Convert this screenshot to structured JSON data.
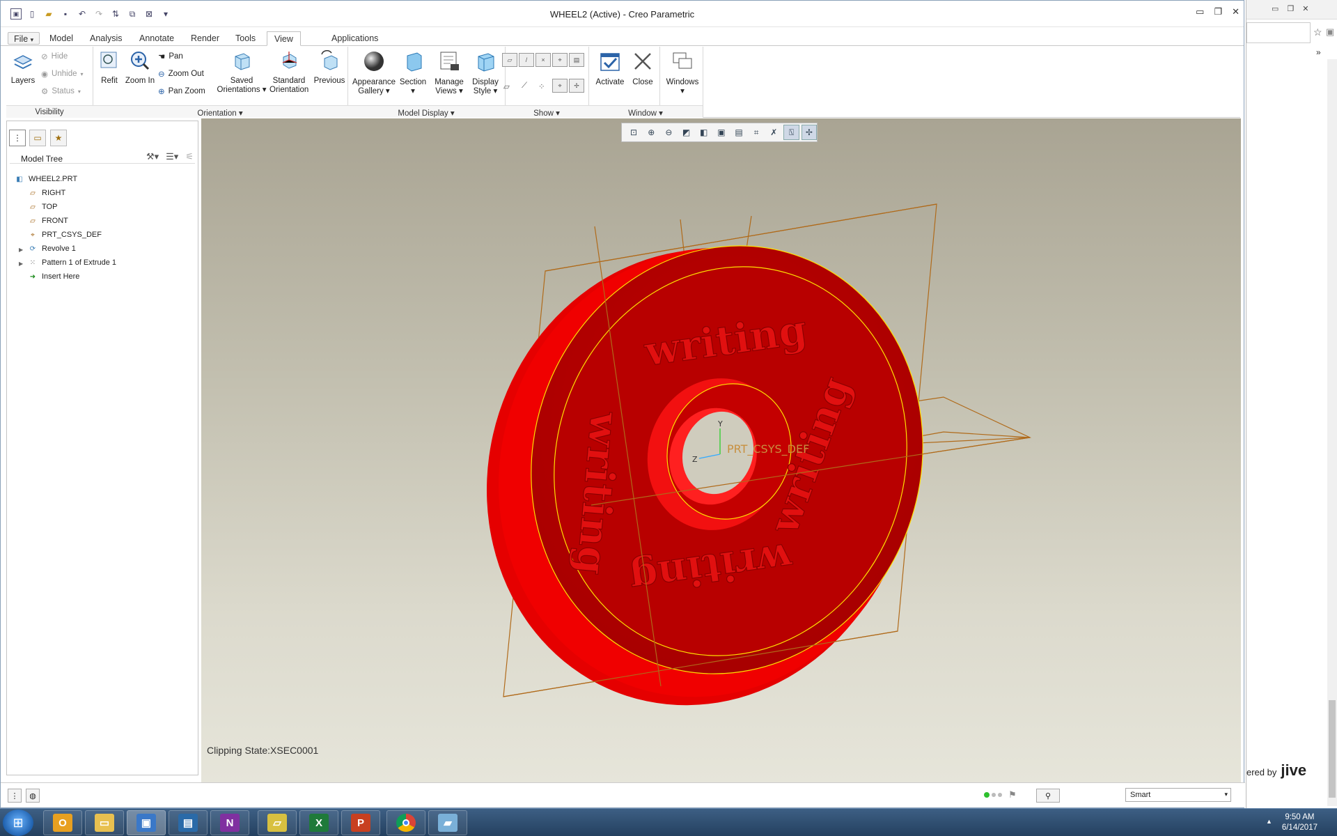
{
  "window": {
    "title": "WHEEL2 (Active) - Creo Parametric",
    "controls": [
      "▭",
      "❐",
      "✕"
    ]
  },
  "tabs": [
    {
      "label": "File",
      "arrow": "▾"
    },
    {
      "label": "Model"
    },
    {
      "label": "Analysis"
    },
    {
      "label": "Annotate"
    },
    {
      "label": "Render"
    },
    {
      "label": "Tools"
    },
    {
      "label": "View"
    },
    {
      "label": "Applications"
    }
  ],
  "ribbon": {
    "layers": "Layers",
    "hide": "Hide",
    "unhide": "Unhide",
    "status": "Status",
    "refit": "Refit",
    "zoom_in": "Zoom In",
    "pan": "Pan",
    "zoom_out": "Zoom Out",
    "pan_zoom": "Pan Zoom",
    "saved_orientations": [
      "Saved",
      "Orientations"
    ],
    "standard_orientation": [
      "Standard",
      "Orientation"
    ],
    "previous": "Previous",
    "appearance_gallery": [
      "Appearance",
      "Gallery"
    ],
    "section": "Section",
    "manage_views": [
      "Manage",
      "Views"
    ],
    "display_style": [
      "Display",
      "Style"
    ],
    "activate": "Activate",
    "close": "Close",
    "windows": "Windows",
    "groups": {
      "visibility": "Visibility",
      "orientation": "Orientation",
      "model_display": "Model Display",
      "show": "Show",
      "window": "Window"
    }
  },
  "model_tree": {
    "header": "Model Tree",
    "items": [
      {
        "label": "WHEEL2.PRT",
        "icon": "part-icon"
      },
      {
        "label": "RIGHT",
        "icon": "datum-plane-icon"
      },
      {
        "label": "TOP",
        "icon": "datum-plane-icon"
      },
      {
        "label": "FRONT",
        "icon": "datum-plane-icon"
      },
      {
        "label": "PRT_CSYS_DEF",
        "icon": "csys-icon"
      },
      {
        "label": "Revolve 1",
        "icon": "revolve-icon"
      },
      {
        "label": "Pattern 1 of Extrude 1",
        "icon": "pattern-icon"
      },
      {
        "label": "Insert Here",
        "icon": "insert-arrow-icon"
      }
    ]
  },
  "viewport": {
    "clipping_state": "Clipping State:XSEC0001",
    "csys_label": "PRT_CSYS_DEF",
    "axis_y": "Y",
    "axis_z": "Z",
    "engraved_text": "writing",
    "colors": {
      "part": "#e80000",
      "part_dark": "#b00000",
      "edge": "#ffe000",
      "datum": "#b06a1a"
    }
  },
  "statusbar": {
    "filter": "Smart"
  },
  "browser": {
    "footer": "ered by",
    "brand": "jive"
  },
  "taskbar": {
    "time": "9:50 AM",
    "date": "6/14/2017"
  }
}
